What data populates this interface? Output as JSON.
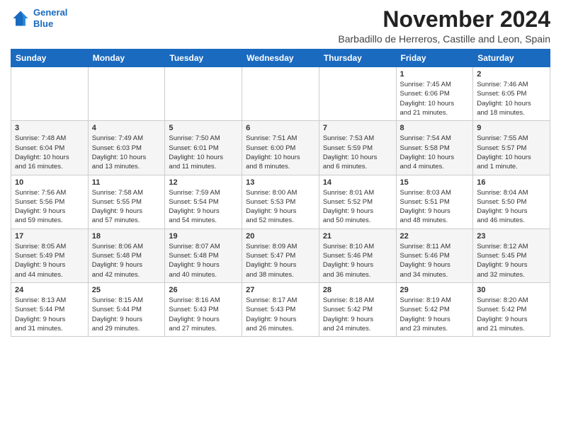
{
  "logo": {
    "line1": "General",
    "line2": "Blue"
  },
  "title": "November 2024",
  "location": "Barbadillo de Herreros, Castille and Leon, Spain",
  "weekdays": [
    "Sunday",
    "Monday",
    "Tuesday",
    "Wednesday",
    "Thursday",
    "Friday",
    "Saturday"
  ],
  "weeks": [
    [
      {
        "day": "",
        "info": ""
      },
      {
        "day": "",
        "info": ""
      },
      {
        "day": "",
        "info": ""
      },
      {
        "day": "",
        "info": ""
      },
      {
        "day": "",
        "info": ""
      },
      {
        "day": "1",
        "info": "Sunrise: 7:45 AM\nSunset: 6:06 PM\nDaylight: 10 hours\nand 21 minutes."
      },
      {
        "day": "2",
        "info": "Sunrise: 7:46 AM\nSunset: 6:05 PM\nDaylight: 10 hours\nand 18 minutes."
      }
    ],
    [
      {
        "day": "3",
        "info": "Sunrise: 7:48 AM\nSunset: 6:04 PM\nDaylight: 10 hours\nand 16 minutes."
      },
      {
        "day": "4",
        "info": "Sunrise: 7:49 AM\nSunset: 6:03 PM\nDaylight: 10 hours\nand 13 minutes."
      },
      {
        "day": "5",
        "info": "Sunrise: 7:50 AM\nSunset: 6:01 PM\nDaylight: 10 hours\nand 11 minutes."
      },
      {
        "day": "6",
        "info": "Sunrise: 7:51 AM\nSunset: 6:00 PM\nDaylight: 10 hours\nand 8 minutes."
      },
      {
        "day": "7",
        "info": "Sunrise: 7:53 AM\nSunset: 5:59 PM\nDaylight: 10 hours\nand 6 minutes."
      },
      {
        "day": "8",
        "info": "Sunrise: 7:54 AM\nSunset: 5:58 PM\nDaylight: 10 hours\nand 4 minutes."
      },
      {
        "day": "9",
        "info": "Sunrise: 7:55 AM\nSunset: 5:57 PM\nDaylight: 10 hours\nand 1 minute."
      }
    ],
    [
      {
        "day": "10",
        "info": "Sunrise: 7:56 AM\nSunset: 5:56 PM\nDaylight: 9 hours\nand 59 minutes."
      },
      {
        "day": "11",
        "info": "Sunrise: 7:58 AM\nSunset: 5:55 PM\nDaylight: 9 hours\nand 57 minutes."
      },
      {
        "day": "12",
        "info": "Sunrise: 7:59 AM\nSunset: 5:54 PM\nDaylight: 9 hours\nand 54 minutes."
      },
      {
        "day": "13",
        "info": "Sunrise: 8:00 AM\nSunset: 5:53 PM\nDaylight: 9 hours\nand 52 minutes."
      },
      {
        "day": "14",
        "info": "Sunrise: 8:01 AM\nSunset: 5:52 PM\nDaylight: 9 hours\nand 50 minutes."
      },
      {
        "day": "15",
        "info": "Sunrise: 8:03 AM\nSunset: 5:51 PM\nDaylight: 9 hours\nand 48 minutes."
      },
      {
        "day": "16",
        "info": "Sunrise: 8:04 AM\nSunset: 5:50 PM\nDaylight: 9 hours\nand 46 minutes."
      }
    ],
    [
      {
        "day": "17",
        "info": "Sunrise: 8:05 AM\nSunset: 5:49 PM\nDaylight: 9 hours\nand 44 minutes."
      },
      {
        "day": "18",
        "info": "Sunrise: 8:06 AM\nSunset: 5:48 PM\nDaylight: 9 hours\nand 42 minutes."
      },
      {
        "day": "19",
        "info": "Sunrise: 8:07 AM\nSunset: 5:48 PM\nDaylight: 9 hours\nand 40 minutes."
      },
      {
        "day": "20",
        "info": "Sunrise: 8:09 AM\nSunset: 5:47 PM\nDaylight: 9 hours\nand 38 minutes."
      },
      {
        "day": "21",
        "info": "Sunrise: 8:10 AM\nSunset: 5:46 PM\nDaylight: 9 hours\nand 36 minutes."
      },
      {
        "day": "22",
        "info": "Sunrise: 8:11 AM\nSunset: 5:46 PM\nDaylight: 9 hours\nand 34 minutes."
      },
      {
        "day": "23",
        "info": "Sunrise: 8:12 AM\nSunset: 5:45 PM\nDaylight: 9 hours\nand 32 minutes."
      }
    ],
    [
      {
        "day": "24",
        "info": "Sunrise: 8:13 AM\nSunset: 5:44 PM\nDaylight: 9 hours\nand 31 minutes."
      },
      {
        "day": "25",
        "info": "Sunrise: 8:15 AM\nSunset: 5:44 PM\nDaylight: 9 hours\nand 29 minutes."
      },
      {
        "day": "26",
        "info": "Sunrise: 8:16 AM\nSunset: 5:43 PM\nDaylight: 9 hours\nand 27 minutes."
      },
      {
        "day": "27",
        "info": "Sunrise: 8:17 AM\nSunset: 5:43 PM\nDaylight: 9 hours\nand 26 minutes."
      },
      {
        "day": "28",
        "info": "Sunrise: 8:18 AM\nSunset: 5:42 PM\nDaylight: 9 hours\nand 24 minutes."
      },
      {
        "day": "29",
        "info": "Sunrise: 8:19 AM\nSunset: 5:42 PM\nDaylight: 9 hours\nand 23 minutes."
      },
      {
        "day": "30",
        "info": "Sunrise: 8:20 AM\nSunset: 5:42 PM\nDaylight: 9 hours\nand 21 minutes."
      }
    ]
  ]
}
